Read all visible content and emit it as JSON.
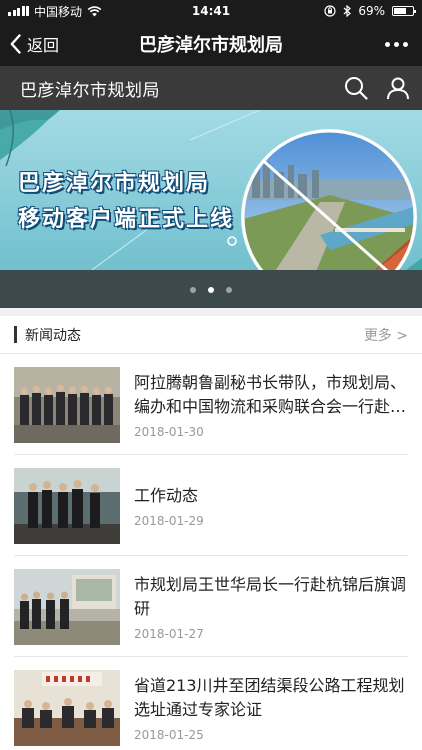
{
  "status_bar": {
    "carrier": "中国移动",
    "time": "14:41",
    "battery": "69%",
    "battery_level": 0.69,
    "icons": [
      "signal-icon",
      "wifi-icon",
      "rotation-lock-icon",
      "bluetooth-icon",
      "battery-icon"
    ]
  },
  "nav": {
    "back_label": "返回",
    "title": "巴彦淖尔市规划局"
  },
  "site_header": {
    "title": "巴彦淖尔市规划局",
    "icons": [
      "search-icon",
      "user-icon"
    ]
  },
  "banner": {
    "line1": "巴彦淖尔市规划局",
    "line2": "移动客户端正式上线",
    "slide_count": 3,
    "active_slide": 2
  },
  "news_section": {
    "title": "新闻动态",
    "more_label": "更多 >",
    "items": [
      {
        "title": "阿拉腾朝鲁副秘书长带队，市规划局、编办和中国物流和采购联合会一行赴辽宁考察",
        "date": "2018-01-30"
      },
      {
        "title": "工作动态",
        "date": "2018-01-29"
      },
      {
        "title": "市规划局王世华局长一行赴杭锦后旗调研",
        "date": "2018-01-27"
      },
      {
        "title": "省道213川井至团结渠段公路工程规划选址通过专家论证",
        "date": "2018-01-25"
      }
    ]
  },
  "colors": {
    "bar_dark": "#1b1b1b",
    "site_bar": "#3a3a3a",
    "banner_sky": "#8fd0dc",
    "banner_text_outline": "#0f4c7a"
  }
}
